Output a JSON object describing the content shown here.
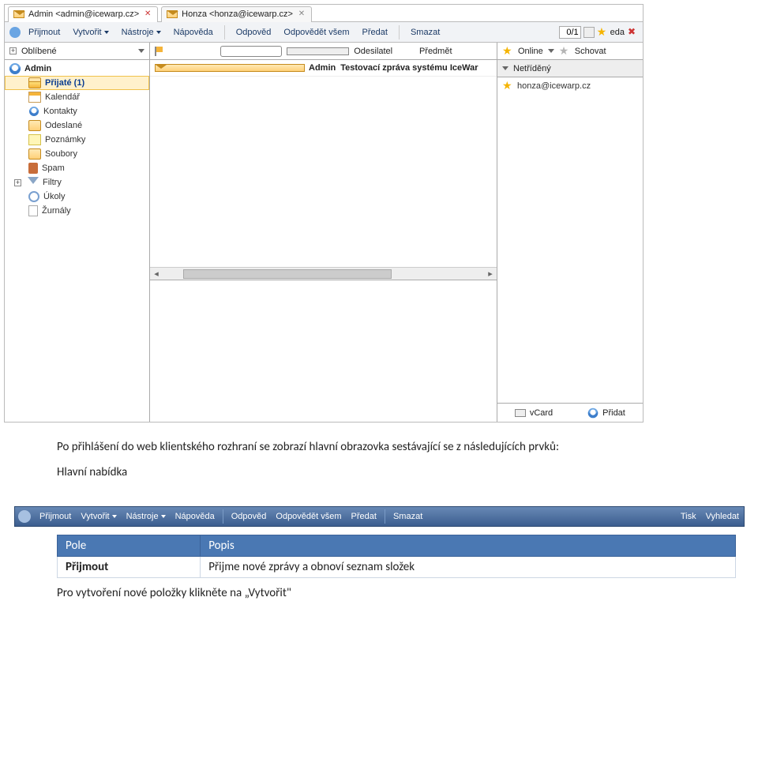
{
  "tabs": [
    {
      "label": "Admin <admin@icewarp.cz>"
    },
    {
      "label": "Honza <honza@icewarp.cz>"
    }
  ],
  "toolbar": {
    "prijmout": "Přijmout",
    "vytvorit": "Vytvořit",
    "nastroje": "Nástroje",
    "napoveda": "Nápověda",
    "odpoved": "Odpověd",
    "odpovedet_vsem": "Odpovědět všem",
    "predat": "Předat",
    "smazat": "Smazat",
    "pager": "0/1",
    "eda": "eda"
  },
  "sidebar": {
    "favorites_label": "Oblíbené",
    "account": "Admin",
    "items": [
      {
        "label": "Přijaté (1)"
      },
      {
        "label": "Kalendář"
      },
      {
        "label": "Kontakty"
      },
      {
        "label": "Odeslané"
      },
      {
        "label": "Poznámky"
      },
      {
        "label": "Soubory"
      },
      {
        "label": "Spam"
      },
      {
        "label": "Filtry"
      },
      {
        "label": "Úkoly"
      },
      {
        "label": "Žurnály"
      }
    ]
  },
  "listpane": {
    "col_sender": "Odesilatel",
    "col_subject": "Předmět",
    "row_sender": "Admin",
    "row_subject": "Testovací zpráva systému IceWar"
  },
  "rightpane": {
    "online": "Online",
    "schovat": "Schovat",
    "group": "Netříděný",
    "contact": "honza@icewarp.cz",
    "vcard": "vCard",
    "pridat": "Přidat"
  },
  "doc": {
    "p1": "Po přihlášení do web klientského rozhraní se zobrazí hlavní obrazovka sestávající  se z následujících prvků:",
    "heading_menu": "Hlavní nabídka",
    "table": {
      "h1": "Pole",
      "h2": "Popis",
      "c1": "Přijmout",
      "c2": "Přijme nové zprávy a obnoví seznam složek"
    },
    "p2": "Pro vytvoření nové položky klikněte na „Vytvořit\""
  },
  "bigtoolbar": {
    "prijmout": "Přijmout",
    "vytvorit": "Vytvořit",
    "nastroje": "Nástroje",
    "napoveda": "Nápověda",
    "odpoved": "Odpověd",
    "odpovedet_vsem": "Odpovědět všem",
    "predat": "Předat",
    "smazat": "Smazat",
    "tisk": "Tisk",
    "vyhledat": "Vyhledat"
  }
}
